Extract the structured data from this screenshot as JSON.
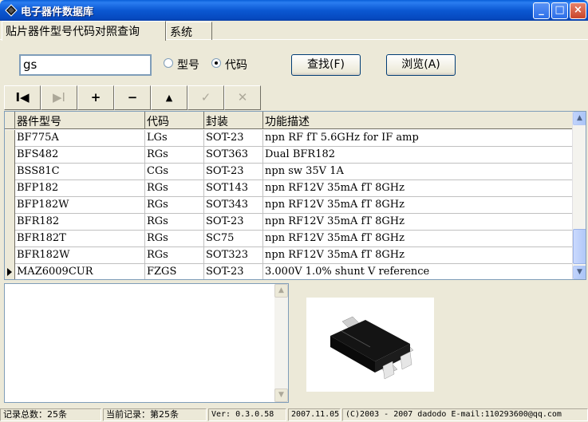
{
  "window": {
    "title": "电子器件数据库",
    "minimize": "_",
    "maximize": "□",
    "close": "×"
  },
  "tabs": [
    {
      "label": "贴片器件型号代码对照查询"
    },
    {
      "label": "系统"
    }
  ],
  "search": {
    "value": "gs",
    "radio_model": "型号",
    "radio_code": "代码",
    "selected": "代码",
    "find_label": "查找(F)",
    "browse_label": "浏览(A)"
  },
  "navigator": {
    "first": "I◀",
    "prior": "▶I",
    "insert": "+",
    "delete": "−",
    "edit": "▲",
    "post": "✓",
    "cancel": "✕"
  },
  "grid": {
    "columns": [
      "器件型号",
      "代码",
      "封装",
      "功能描述"
    ],
    "rows": [
      [
        "BF775A",
        "LGs",
        "SOT-23",
        "npn RF fT 5.6GHz for IF amp"
      ],
      [
        "BFS482",
        "RGs",
        "SOT363",
        "Dual BFR182"
      ],
      [
        "BSS81C",
        "CGs",
        "SOT-23",
        "npn sw 35V 1A"
      ],
      [
        "BFP182",
        "RGs",
        "SOT143",
        "npn RF12V 35mA fT 8GHz"
      ],
      [
        "BFP182W",
        "RGs",
        "SOT343",
        "npn RF12V 35mA fT 8GHz"
      ],
      [
        "BFR182",
        "RGs",
        "SOT-23",
        "npn RF12V 35mA fT 8GHz"
      ],
      [
        "BFR182T",
        "RGs",
        "SC75",
        "npn RF12V 35mA fT 8GHz"
      ],
      [
        "BFR182W",
        "RGs",
        "SOT323",
        "npn RF12V 35mA fT 8GHz"
      ],
      [
        "MAZ6009CUR",
        "FZGS",
        "SOT-23",
        "3.000V 1.0% shunt V reference"
      ]
    ],
    "current_row": 8
  },
  "status": {
    "total": "记录总数：25条",
    "current": "当前记录：第25条",
    "version": "Ver: 0.3.0.58",
    "date": "2007.11.05",
    "copyright": "(C)2003 - 2007  dadodo  E-mail:110293600@qq.com"
  },
  "colors": {
    "titlebar": "#0b58d2",
    "face": "#ece9d8",
    "border": "#7f9db9"
  }
}
